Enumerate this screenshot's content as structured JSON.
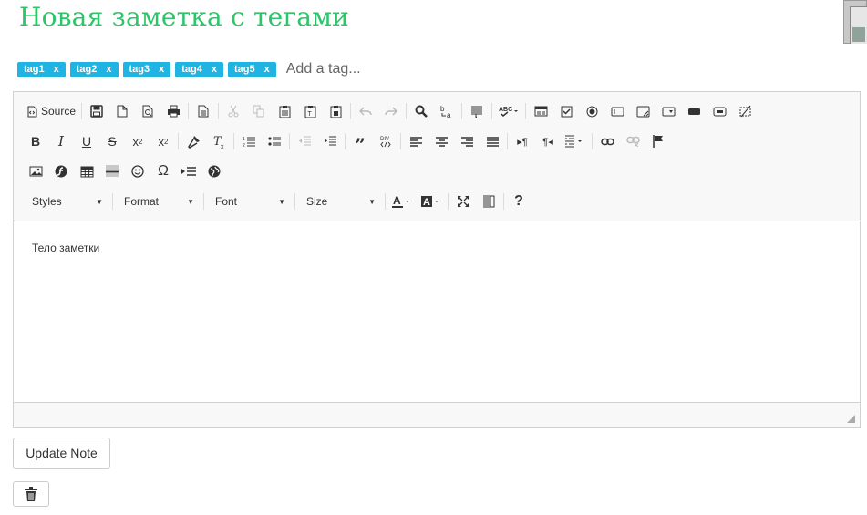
{
  "page": {
    "title": "Новая заметка с тегами"
  },
  "tags": {
    "items": [
      {
        "label": "tag1",
        "remove": "x"
      },
      {
        "label": "tag2",
        "remove": "x"
      },
      {
        "label": "tag3",
        "remove": "x"
      },
      {
        "label": "tag4",
        "remove": "x"
      },
      {
        "label": "tag5",
        "remove": "x"
      }
    ],
    "placeholder": "Add a tag..."
  },
  "toolbar": {
    "source_label": "Source",
    "combos": {
      "styles": "Styles",
      "format": "Format",
      "font": "Font",
      "size": "Size"
    }
  },
  "editor": {
    "body": "Тело заметки"
  },
  "actions": {
    "update_label": "Update Note"
  },
  "colors": {
    "title": "#2ec56a",
    "tag_bg": "#20b4e2"
  }
}
